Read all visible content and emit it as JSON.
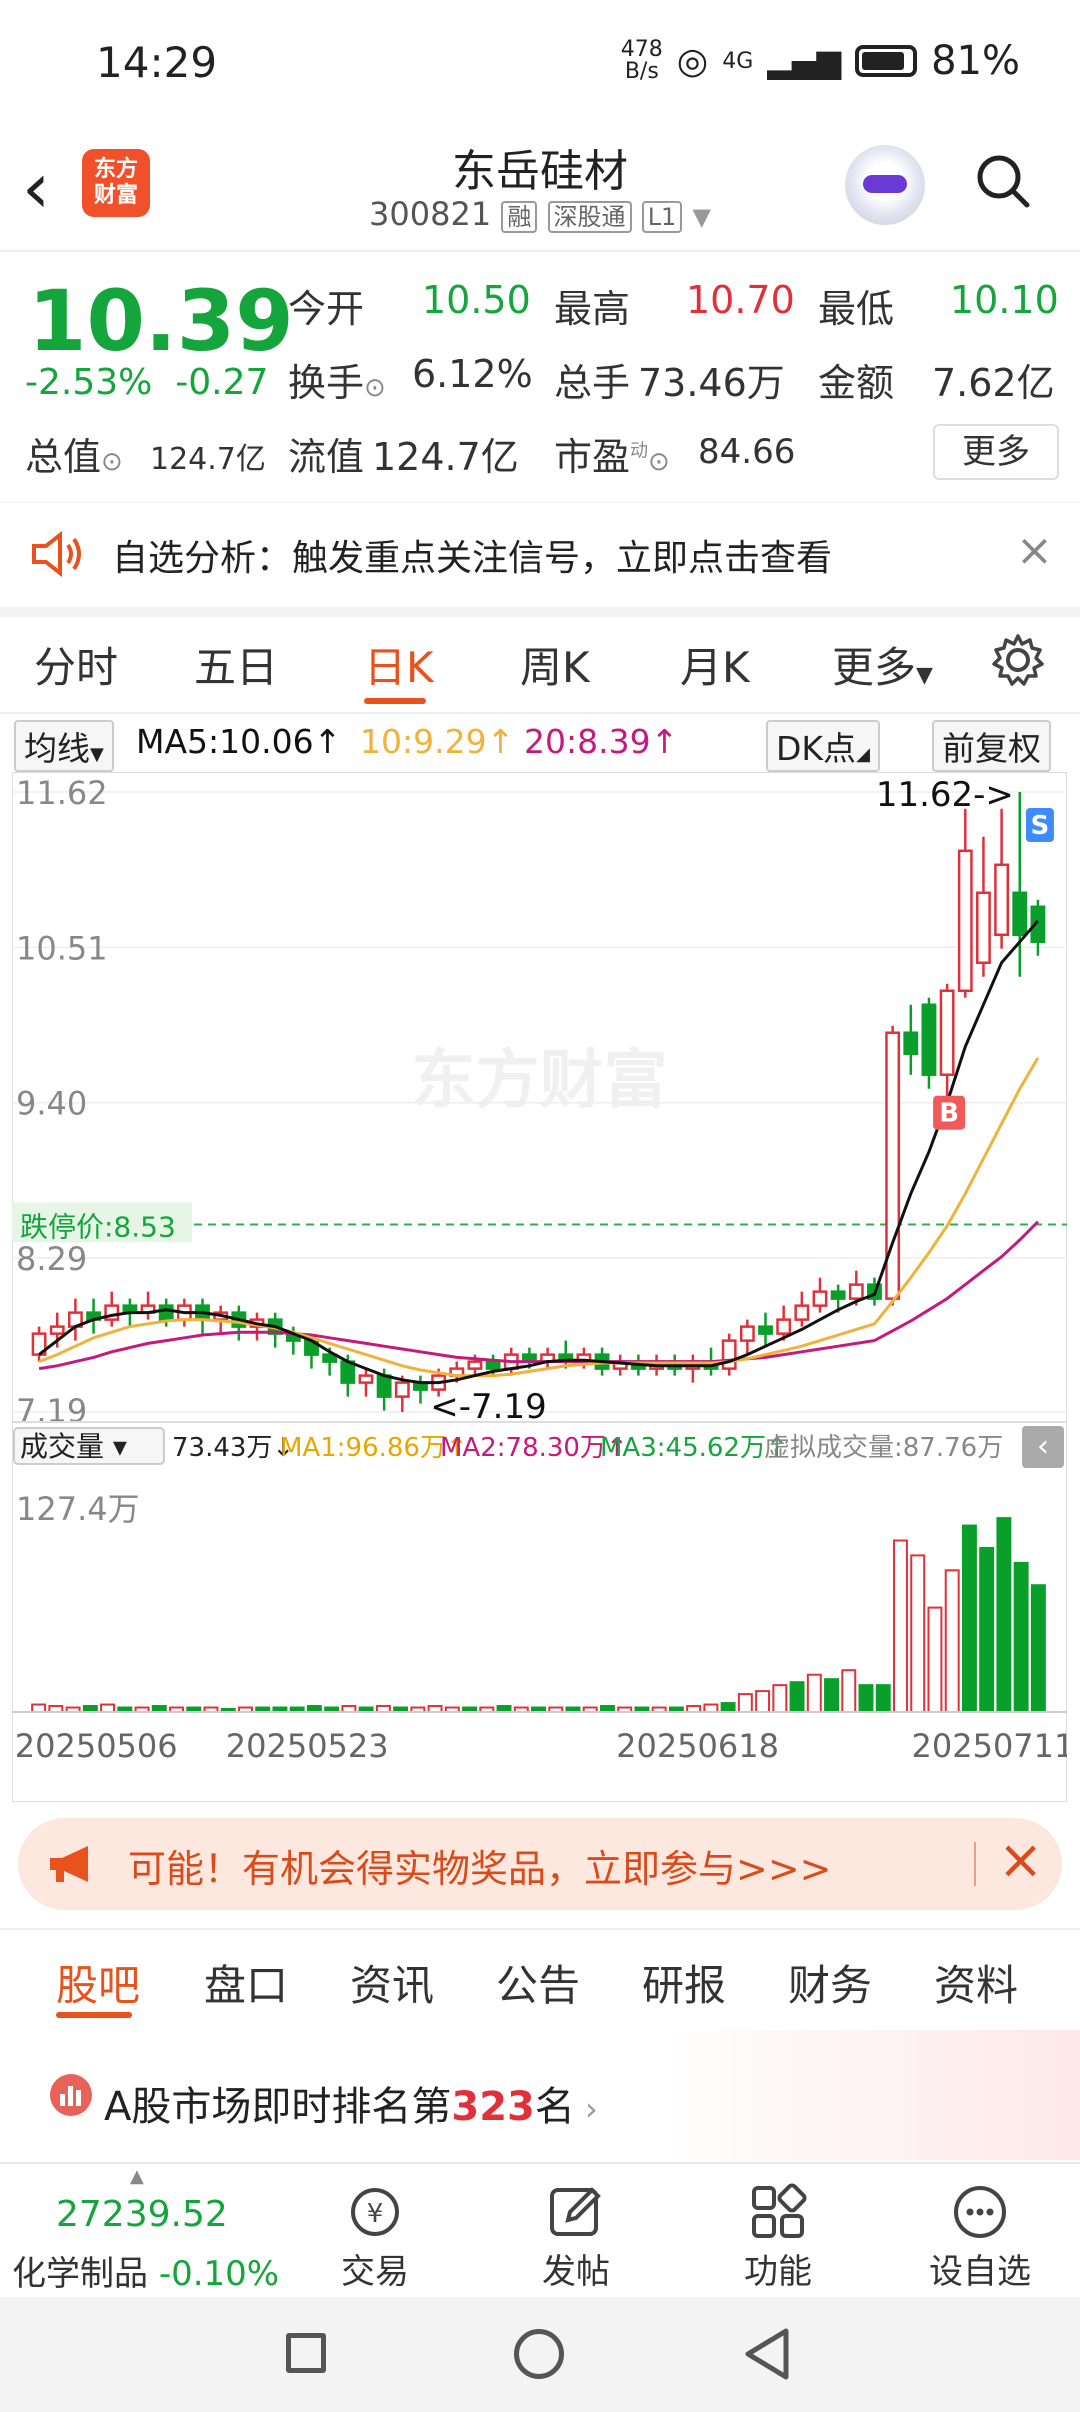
{
  "status": {
    "time": "14:29",
    "net_speed_top": "478",
    "net_speed_bottom": "B/s",
    "signal": "4G",
    "battery": "81%"
  },
  "header": {
    "logo_line1": "东方",
    "logo_line2": "财富",
    "title": "东岳硅材",
    "code": "300821",
    "tag1": "融",
    "tag2": "深股通",
    "tag3": "L1"
  },
  "quote": {
    "price": "10.39",
    "change_pct": "-2.53%",
    "change": "-0.27",
    "open_label": "今开",
    "open": "10.50",
    "high_label": "最高",
    "high": "10.70",
    "low_label": "最低",
    "low": "10.10",
    "turnover_label": "换手",
    "turnover": "6.12%",
    "volume_label": "总手",
    "volume": "73.46万",
    "amount_label": "金额",
    "amount": "7.62亿",
    "total_value_label": "总值",
    "total_value": "124.7亿",
    "float_value_label": "流值",
    "float_value": "124.7亿",
    "pe_label": "市盈",
    "pe_sup": "动",
    "pe": "84.66",
    "more": "更多"
  },
  "alert": {
    "text": "自选分析：触发重点关注信号，立即点击查看"
  },
  "tabs": [
    "分时",
    "五日",
    "日K",
    "周K",
    "月K",
    "更多"
  ],
  "ma": {
    "selector": "均线",
    "ma5": "MA5:10.06↑",
    "ma10": "10:9.29↑",
    "ma20": "20:8.39↑",
    "dk": "DK点",
    "adjust": "前复权"
  },
  "chart": {
    "watermark": "东方财富",
    "y_labels": [
      "11.62",
      "10.51",
      "9.40",
      "8.29",
      "7.19"
    ],
    "max_tag": "11.62->",
    "min_tag": "<-7.19",
    "limit_down_label": "跌停价:8.53",
    "s_marker": "S",
    "b_marker": "B",
    "vol_selector": "成交量",
    "vol_value": "73.43万↓",
    "vol_ma1": "MA1:96.86万↑",
    "vol_ma2": "MA2:78.30万↑",
    "vol_ma3": "MA3:45.62万↑",
    "virtual_vol": "虚拟成交量:87.76万",
    "vol_max": "127.4万",
    "dates": [
      "20250506",
      "20250523",
      "20250618",
      "20250711"
    ],
    "colors": {
      "up": "#e0313a",
      "down": "#0a9e2a",
      "ma5": "#111111",
      "ma10": "#f0b23a",
      "ma20": "#c41a7e"
    }
  },
  "chart_data": {
    "type": "candlestick",
    "ylim": [
      7.19,
      11.62
    ],
    "candles": [
      [
        7.6,
        7.75,
        7.55,
        7.8
      ],
      [
        7.75,
        7.8,
        7.65,
        7.9
      ],
      [
        7.8,
        7.9,
        7.7,
        8.0
      ],
      [
        7.9,
        7.85,
        7.75,
        8.0
      ],
      [
        7.85,
        7.95,
        7.8,
        8.05
      ],
      [
        7.95,
        7.9,
        7.8,
        8.0
      ],
      [
        7.9,
        7.95,
        7.85,
        8.05
      ],
      [
        7.95,
        7.85,
        7.8,
        8.0
      ],
      [
        7.85,
        7.95,
        7.8,
        8.0
      ],
      [
        7.95,
        7.85,
        7.75,
        8.0
      ],
      [
        7.85,
        7.9,
        7.75,
        7.95
      ],
      [
        7.9,
        7.8,
        7.7,
        7.95
      ],
      [
        7.8,
        7.85,
        7.7,
        7.9
      ],
      [
        7.85,
        7.75,
        7.65,
        7.9
      ],
      [
        7.75,
        7.7,
        7.6,
        7.8
      ],
      [
        7.7,
        7.6,
        7.5,
        7.75
      ],
      [
        7.6,
        7.55,
        7.45,
        7.65
      ],
      [
        7.55,
        7.4,
        7.3,
        7.6
      ],
      [
        7.4,
        7.45,
        7.3,
        7.5
      ],
      [
        7.45,
        7.3,
        7.2,
        7.5
      ],
      [
        7.3,
        7.4,
        7.19,
        7.45
      ],
      [
        7.4,
        7.35,
        7.25,
        7.45
      ],
      [
        7.35,
        7.45,
        7.3,
        7.5
      ],
      [
        7.45,
        7.5,
        7.4,
        7.55
      ],
      [
        7.5,
        7.55,
        7.45,
        7.6
      ],
      [
        7.55,
        7.5,
        7.45,
        7.6
      ],
      [
        7.5,
        7.6,
        7.45,
        7.65
      ],
      [
        7.6,
        7.55,
        7.5,
        7.65
      ],
      [
        7.55,
        7.6,
        7.5,
        7.65
      ],
      [
        7.6,
        7.55,
        7.5,
        7.7
      ],
      [
        7.55,
        7.6,
        7.5,
        7.65
      ],
      [
        7.6,
        7.5,
        7.45,
        7.65
      ],
      [
        7.5,
        7.55,
        7.45,
        7.6
      ],
      [
        7.55,
        7.5,
        7.45,
        7.6
      ],
      [
        7.5,
        7.55,
        7.45,
        7.6
      ],
      [
        7.55,
        7.5,
        7.45,
        7.6
      ],
      [
        7.5,
        7.55,
        7.4,
        7.6
      ],
      [
        7.55,
        7.5,
        7.45,
        7.65
      ],
      [
        7.5,
        7.7,
        7.45,
        7.75
      ],
      [
        7.7,
        7.8,
        7.6,
        7.85
      ],
      [
        7.8,
        7.75,
        7.65,
        7.9
      ],
      [
        7.75,
        7.85,
        7.7,
        7.95
      ],
      [
        7.85,
        7.95,
        7.8,
        8.05
      ],
      [
        7.95,
        8.05,
        7.9,
        8.15
      ],
      [
        8.05,
        8.0,
        7.9,
        8.1
      ],
      [
        8.0,
        8.1,
        7.95,
        8.2
      ],
      [
        8.1,
        8.0,
        7.95,
        8.15
      ],
      [
        8.0,
        9.9,
        7.95,
        9.95
      ],
      [
        9.9,
        9.75,
        9.6,
        10.1
      ],
      [
        10.1,
        9.6,
        9.5,
        10.15
      ],
      [
        9.6,
        10.2,
        9.3,
        10.25
      ],
      [
        10.2,
        11.2,
        10.15,
        11.5
      ],
      [
        10.4,
        10.9,
        10.3,
        11.3
      ],
      [
        10.6,
        11.1,
        10.5,
        11.5
      ],
      [
        10.9,
        10.6,
        10.3,
        11.62
      ],
      [
        10.8,
        10.55,
        10.45,
        10.85
      ]
    ],
    "ma5": [
      7.6,
      7.7,
      7.8,
      7.85,
      7.88,
      7.9,
      7.9,
      7.92,
      7.9,
      7.9,
      7.88,
      7.85,
      7.82,
      7.8,
      7.75,
      7.7,
      7.62,
      7.55,
      7.5,
      7.45,
      7.42,
      7.4,
      7.4,
      7.42,
      7.45,
      7.48,
      7.5,
      7.52,
      7.55,
      7.56,
      7.56,
      7.55,
      7.54,
      7.53,
      7.52,
      7.52,
      7.52,
      7.52,
      7.55,
      7.6,
      7.66,
      7.72,
      7.78,
      7.85,
      7.92,
      7.98,
      8.03,
      8.4,
      8.75,
      9.05,
      9.4,
      9.8,
      10.1,
      10.4,
      10.55,
      10.7
    ],
    "ma10": [
      7.55,
      7.6,
      7.66,
      7.72,
      7.76,
      7.8,
      7.82,
      7.84,
      7.85,
      7.85,
      7.84,
      7.83,
      7.81,
      7.79,
      7.76,
      7.72,
      7.68,
      7.64,
      7.6,
      7.56,
      7.52,
      7.49,
      7.47,
      7.45,
      7.45,
      7.45,
      7.46,
      7.48,
      7.5,
      7.52,
      7.53,
      7.54,
      7.54,
      7.54,
      7.54,
      7.54,
      7.54,
      7.54,
      7.55,
      7.57,
      7.6,
      7.63,
      7.66,
      7.7,
      7.74,
      7.78,
      7.82,
      7.98,
      8.15,
      8.33,
      8.52,
      8.75,
      9.0,
      9.25,
      9.5,
      9.72
    ],
    "ma20": [
      7.5,
      7.52,
      7.55,
      7.58,
      7.62,
      7.65,
      7.68,
      7.7,
      7.72,
      7.74,
      7.75,
      7.76,
      7.76,
      7.76,
      7.75,
      7.74,
      7.72,
      7.7,
      7.68,
      7.66,
      7.64,
      7.62,
      7.6,
      7.58,
      7.57,
      7.56,
      7.55,
      7.55,
      7.55,
      7.55,
      7.55,
      7.55,
      7.55,
      7.55,
      7.55,
      7.55,
      7.55,
      7.55,
      7.56,
      7.57,
      7.58,
      7.6,
      7.62,
      7.64,
      7.66,
      7.68,
      7.7,
      7.77,
      7.84,
      7.92,
      8.0,
      8.1,
      8.2,
      8.3,
      8.42,
      8.55
    ],
    "volume": [
      5,
      4,
      3,
      4,
      5,
      3,
      3,
      4,
      3,
      3,
      3,
      2,
      3,
      3,
      3,
      3,
      4,
      3,
      4,
      3,
      4,
      3,
      3,
      4,
      3,
      3,
      3,
      4,
      3,
      3,
      3,
      3,
      3,
      4,
      3,
      3,
      3,
      3,
      4,
      5,
      6,
      12,
      14,
      18,
      20,
      25,
      22,
      28,
      18,
      18,
      115,
      105,
      70,
      95,
      125,
      110,
      130,
      100,
      85
    ],
    "vol_ylim": [
      0,
      127.4
    ]
  },
  "banner": {
    "text": "可能！有机会得实物奖品，立即参与>>>"
  },
  "bottom_tabs": [
    "股吧",
    "盘口",
    "资讯",
    "公告",
    "研报",
    "财务",
    "资料"
  ],
  "rank": {
    "prefix": "A股市场即时排名第",
    "number": "323",
    "suffix": "名"
  },
  "nav": {
    "index_value": "27239.52",
    "index_name": "化学制品",
    "index_change": "-0.10%",
    "trade": "交易",
    "post": "发帖",
    "func": "功能",
    "watch": "设自选"
  }
}
